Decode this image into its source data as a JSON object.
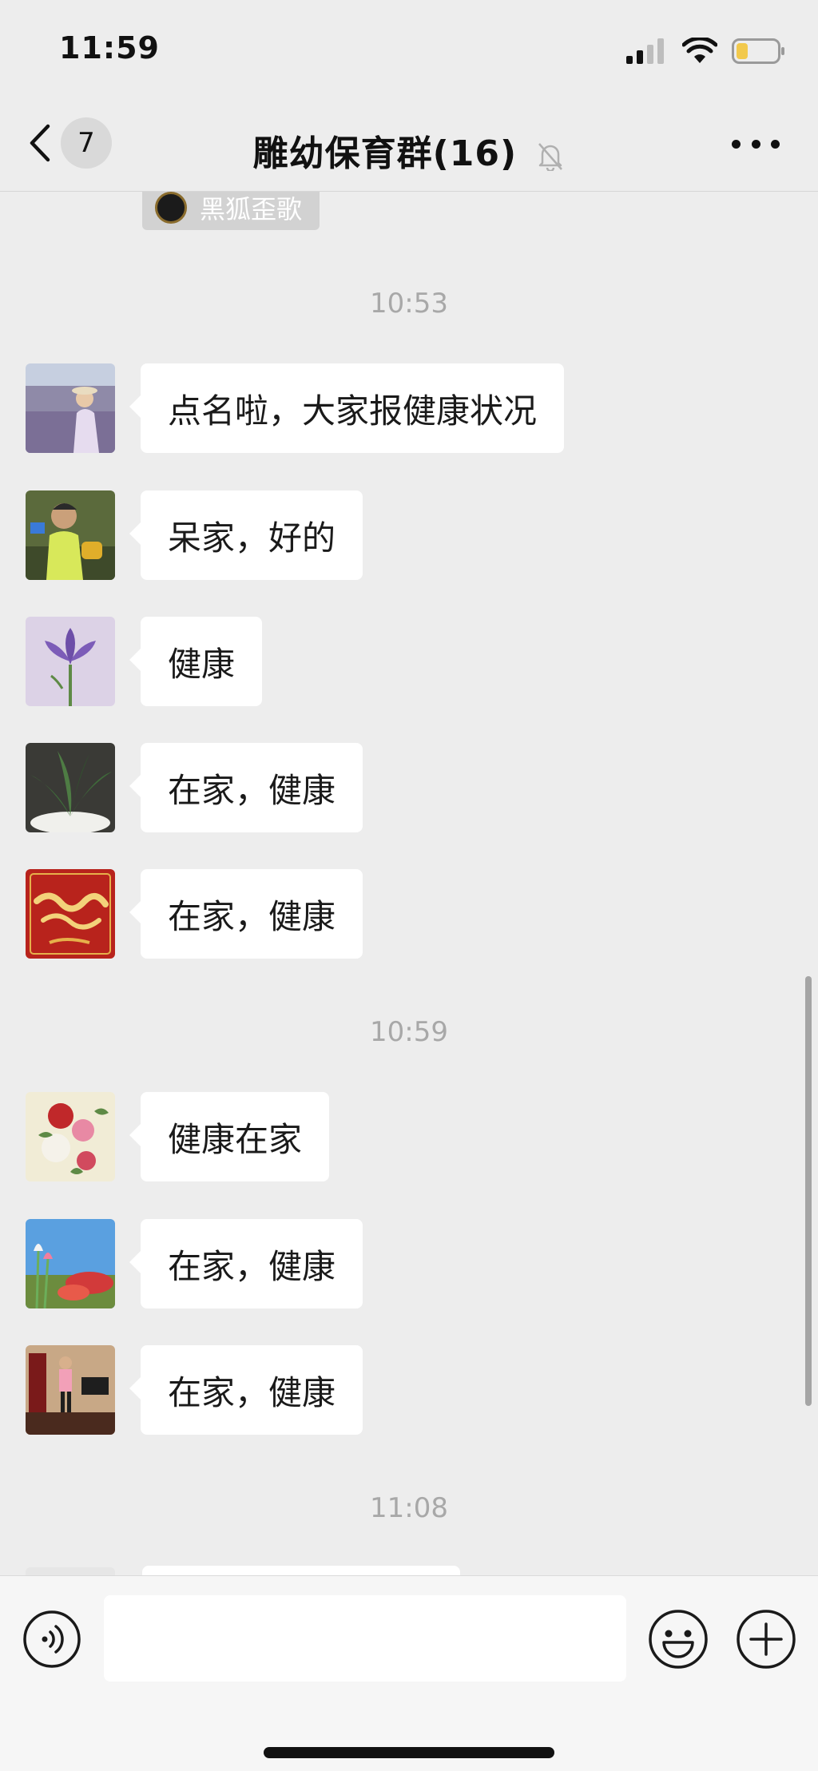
{
  "status_bar": {
    "time": "11:59"
  },
  "nav": {
    "back_count": "7",
    "title": "雕幼保育群(16)"
  },
  "forward_chip": {
    "name": "黑狐歪歌"
  },
  "timestamps": [
    "10:53",
    "10:59",
    "11:08"
  ],
  "messages": [
    {
      "avatar": "avatar-lavender-field",
      "text": "点名啦，大家报健康状况"
    },
    {
      "avatar": "avatar-boy-playing",
      "text": "呆家，好的"
    },
    {
      "avatar": "avatar-purple-iris",
      "text": "健康"
    },
    {
      "avatar": "avatar-potted-plant",
      "text": "在家，健康"
    },
    {
      "avatar": "avatar-new-year-card",
      "text": "在家，健康"
    },
    {
      "avatar": "avatar-peony-flowers",
      "text": "健康在家"
    },
    {
      "avatar": "avatar-tulips-sky",
      "text": "在家，健康"
    },
    {
      "avatar": "avatar-person-indoors",
      "text": "在家，健康"
    }
  ],
  "input": {
    "text": ""
  },
  "colors": {
    "background": "#ededed",
    "bubble": "#ffffff",
    "timestamp": "#a8a8a8"
  }
}
